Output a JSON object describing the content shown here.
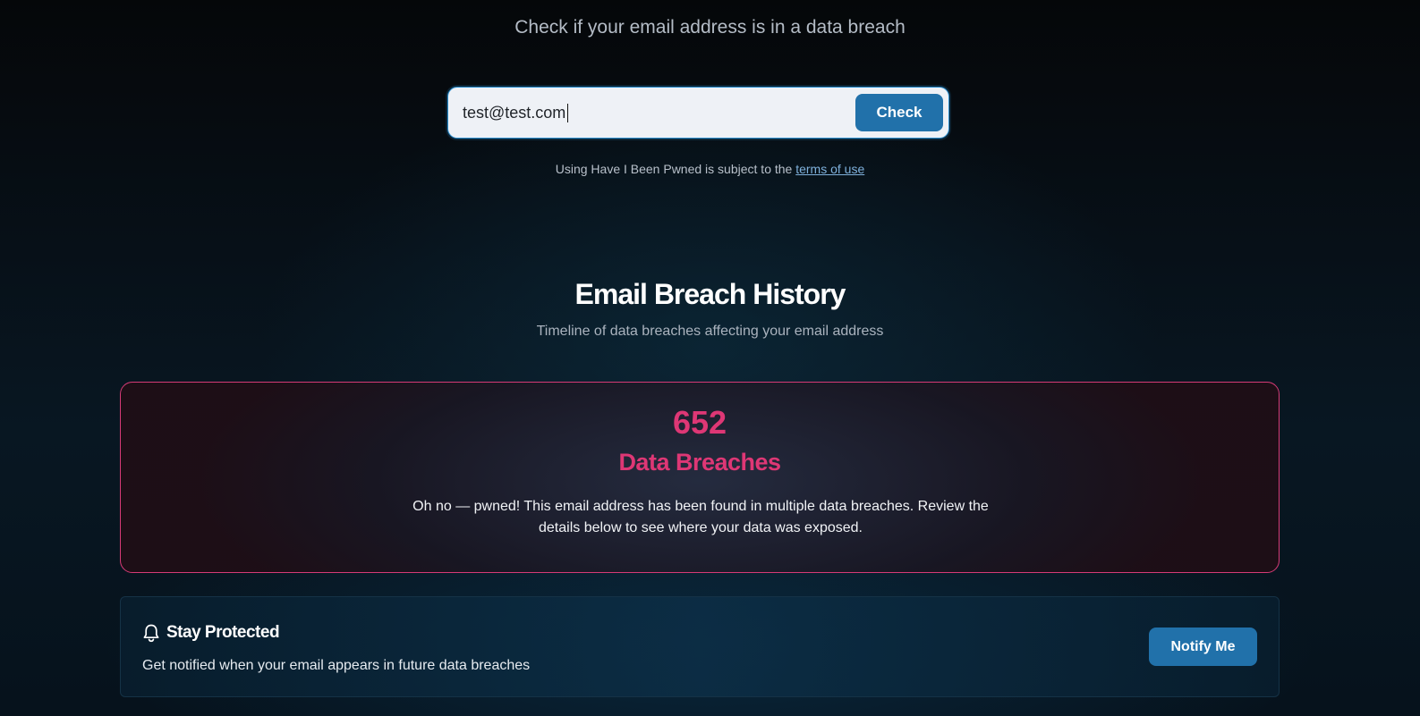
{
  "search": {
    "heading": "Check if your email address is in a data breach",
    "value": "test@test.com",
    "button_label": "Check",
    "terms_prefix": "Using Have I Been Pwned is subject to the",
    "terms_link": "terms of use"
  },
  "history": {
    "title": "Email Breach History",
    "subtitle": "Timeline of data breaches affecting your email address"
  },
  "breach_summary": {
    "count": "652",
    "label": "Data Breaches",
    "message": "Oh no — pwned! This email address has been found in multiple data breaches. Review the details below to see where your data was exposed.",
    "accent_color": "#de3775"
  },
  "protect": {
    "icon": "bell-icon",
    "title": "Stay Protected",
    "text": "Get notified when your email appears in future data breaches",
    "button_label": "Notify Me"
  },
  "colors": {
    "primary_button": "#2171aa",
    "input_border": "#2a8fd0"
  }
}
